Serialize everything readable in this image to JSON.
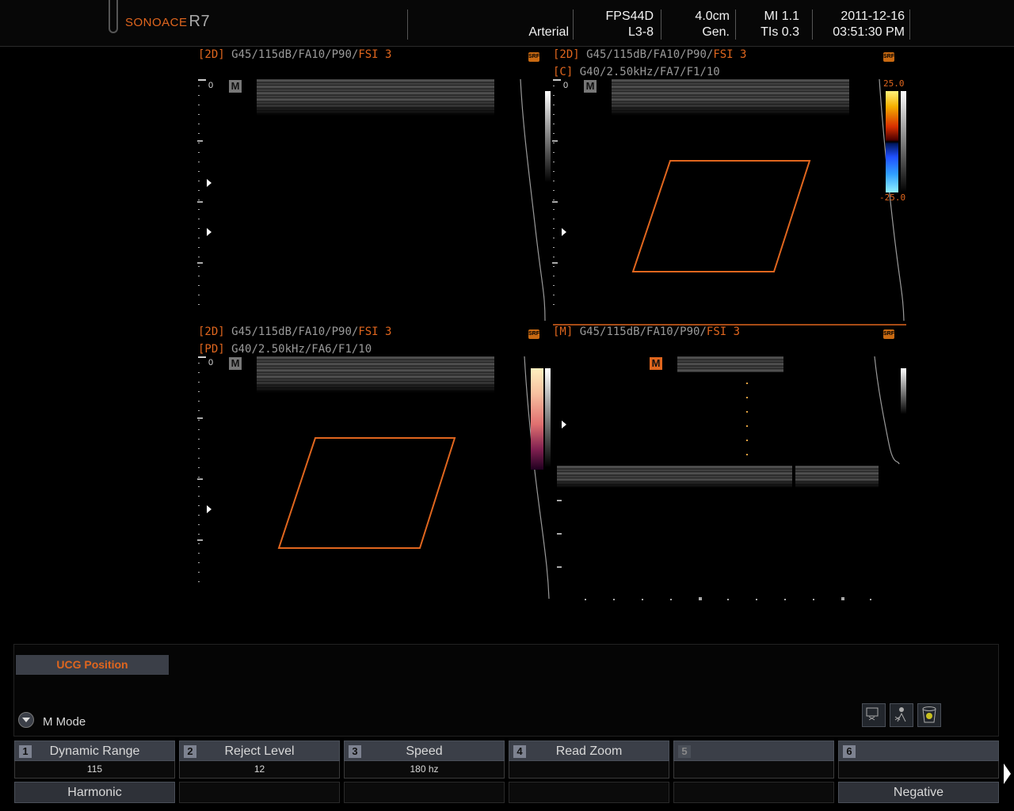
{
  "header": {
    "brand": "SONOACE",
    "model": "R7",
    "preset": "Arterial",
    "probe": "FPS44D",
    "probe_sub": "L3-8",
    "depth": "4.0cm",
    "mode": "Gen.",
    "mi": "MI 1.1",
    "tis": "TIs 0.3",
    "date": "2011-12-16",
    "time": "03:51:30 PM"
  },
  "viewports": {
    "top_left": {
      "label_bracket": "[2D]",
      "label_params": "G45/115dB/FA10/P90/",
      "label_fsi": "FSI 3",
      "srf": "SRF",
      "m_icon": "M",
      "zero": "0"
    },
    "top_right": {
      "label_bracket": "[2D]",
      "label_params": "G45/115dB/FA10/P90/",
      "label_fsi": "FSI 3",
      "label2_bracket": "[C]",
      "label2_params": "G40/2.50kHz/FA7/F1/10",
      "srf": "SRF",
      "m_icon": "M",
      "zero": "0",
      "scale_top": "25.0",
      "scale_bottom": "-25.0"
    },
    "bottom_left": {
      "label_bracket": "[2D]",
      "label_params": "G45/115dB/FA10/P90/",
      "label_fsi": "FSI 3",
      "label2_bracket": "[PD]",
      "label2_params": "G40/2.50kHz/FA6/F1/10",
      "srf": "SRF",
      "m_icon": "M",
      "zero": "0"
    },
    "bottom_right": {
      "label_bracket": "[M]",
      "label_params": "G45/115dB/FA10/P90/",
      "label_fsi": "FSI 3",
      "srf": "SRF",
      "m_icon": "M"
    }
  },
  "panel": {
    "ucg_button": "UCG Position",
    "mode_label": "M Mode",
    "tools": [
      "exit-icon",
      "patient-icon",
      "trash-icon"
    ]
  },
  "softkeys": [
    {
      "num": "1",
      "title": "Dynamic Range",
      "value": "115",
      "bottom": "Harmonic"
    },
    {
      "num": "2",
      "title": "Reject Level",
      "value": "12",
      "bottom": ""
    },
    {
      "num": "3",
      "title": "Speed",
      "value": "180 hz",
      "bottom": ""
    },
    {
      "num": "4",
      "title": "Read Zoom",
      "value": "",
      "bottom": ""
    },
    {
      "num": "5",
      "title": "",
      "value": "",
      "bottom": ""
    },
    {
      "num": "6",
      "title": "",
      "value": "",
      "bottom": "Negative"
    }
  ],
  "colors": {
    "accent": "#e0661e",
    "roi": "#e0661e",
    "button_bg": "#3b3f48"
  }
}
